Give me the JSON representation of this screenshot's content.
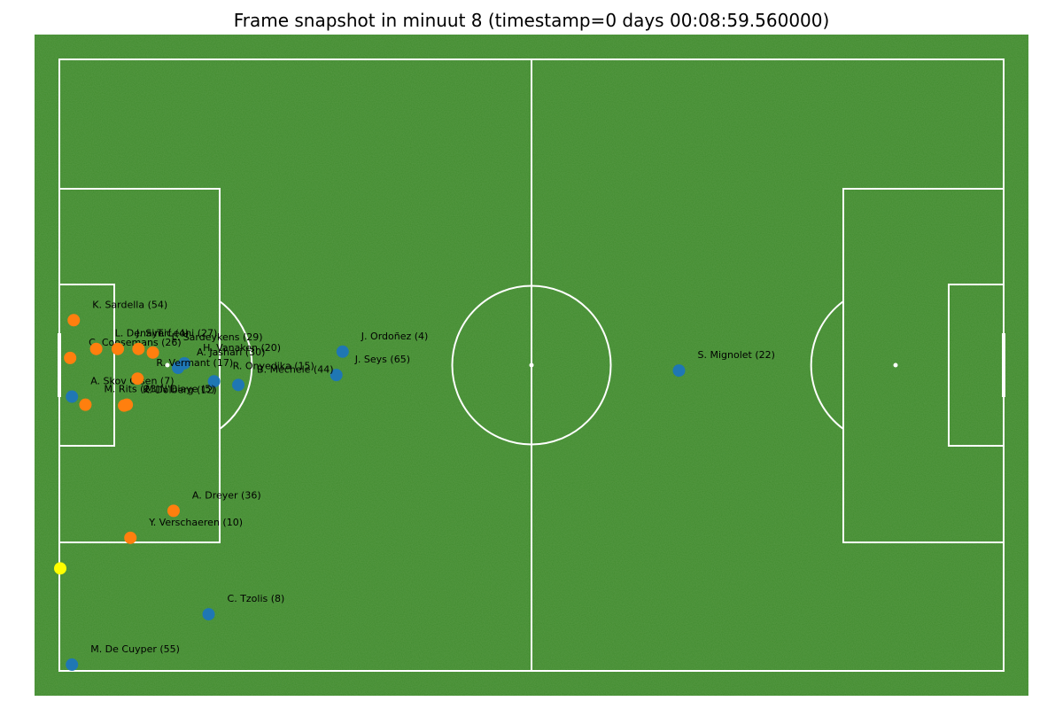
{
  "chart_data": {
    "type": "scatter",
    "title": "Frame snapshot in minuut 8 (timestamp=0 days 00:08:59.560000)",
    "xlim": [
      -52.5,
      52.5
    ],
    "ylim": [
      -34,
      34
    ],
    "pitch_color": "#3f8a2c",
    "line_color": "#ffffff",
    "series": [
      {
        "color": "#1f77b4",
        "players": [
          {
            "label": "J. Ordoñez (4)",
            "x": -21.0,
            "y": 1.5
          },
          {
            "label": "J. Seys (65)",
            "x": -21.7,
            "y": -1.1
          },
          {
            "label": "S. Mignolet (22)",
            "x": 16.4,
            "y": -0.6
          },
          {
            "label": "B. Mechele (44)",
            "x": -32.6,
            "y": -2.2
          },
          {
            "label": "R. Onyedika (15)",
            "x": -35.3,
            "y": -1.8
          },
          {
            "label": "H. Vanaken (20)",
            "x": -38.6,
            "y": 0.2
          },
          {
            "label": "A. Jashari (30)",
            "x": -39.3,
            "y": -0.3
          },
          {
            "label": "A. Skov Olsen (7)",
            "x": -51.1,
            "y": -3.5
          },
          {
            "label": "C. Tzolis (8)",
            "x": -35.9,
            "y": -27.7
          },
          {
            "label": "M. De Cuyper (55)",
            "x": -51.1,
            "y": -33.3
          }
        ]
      },
      {
        "color": "#ff7f0e",
        "players": [
          {
            "label": "K. Sardella (54)",
            "x": -50.9,
            "y": 5.0
          },
          {
            "label": "C. Coosemans (26)",
            "x": -51.3,
            "y": 0.8
          },
          {
            "label": "L. Denayer",
            "x": -48.4,
            "y": 1.8
          },
          {
            "label": "J. Simić (4)",
            "x": -46.0,
            "y": 1.8
          },
          {
            "label": "T. Leoni (27)",
            "x": -43.7,
            "y": 1.8
          },
          {
            "label": "L. Sardeykens (29)",
            "x": -42.1,
            "y": 1.4
          },
          {
            "label": "R. Vermant (17)",
            "x": -43.8,
            "y": -1.5
          },
          {
            "label": "K. Dolberg (12)",
            "x": -45.3,
            "y": -4.5
          },
          {
            "label": "M. Rits (23)",
            "x": -49.6,
            "y": -4.4
          },
          {
            "label": "M. N'Diaye (5)",
            "x": -45.0,
            "y": -4.4
          },
          {
            "label": "A. Dreyer (36)",
            "x": -39.8,
            "y": -16.2
          },
          {
            "label": "Y. Verschaeren (10)",
            "x": -44.6,
            "y": -19.2
          }
        ]
      },
      {
        "color": "#ffff00",
        "players": [
          {
            "label": "",
            "x": -52.4,
            "y": -22.6
          }
        ]
      }
    ]
  }
}
